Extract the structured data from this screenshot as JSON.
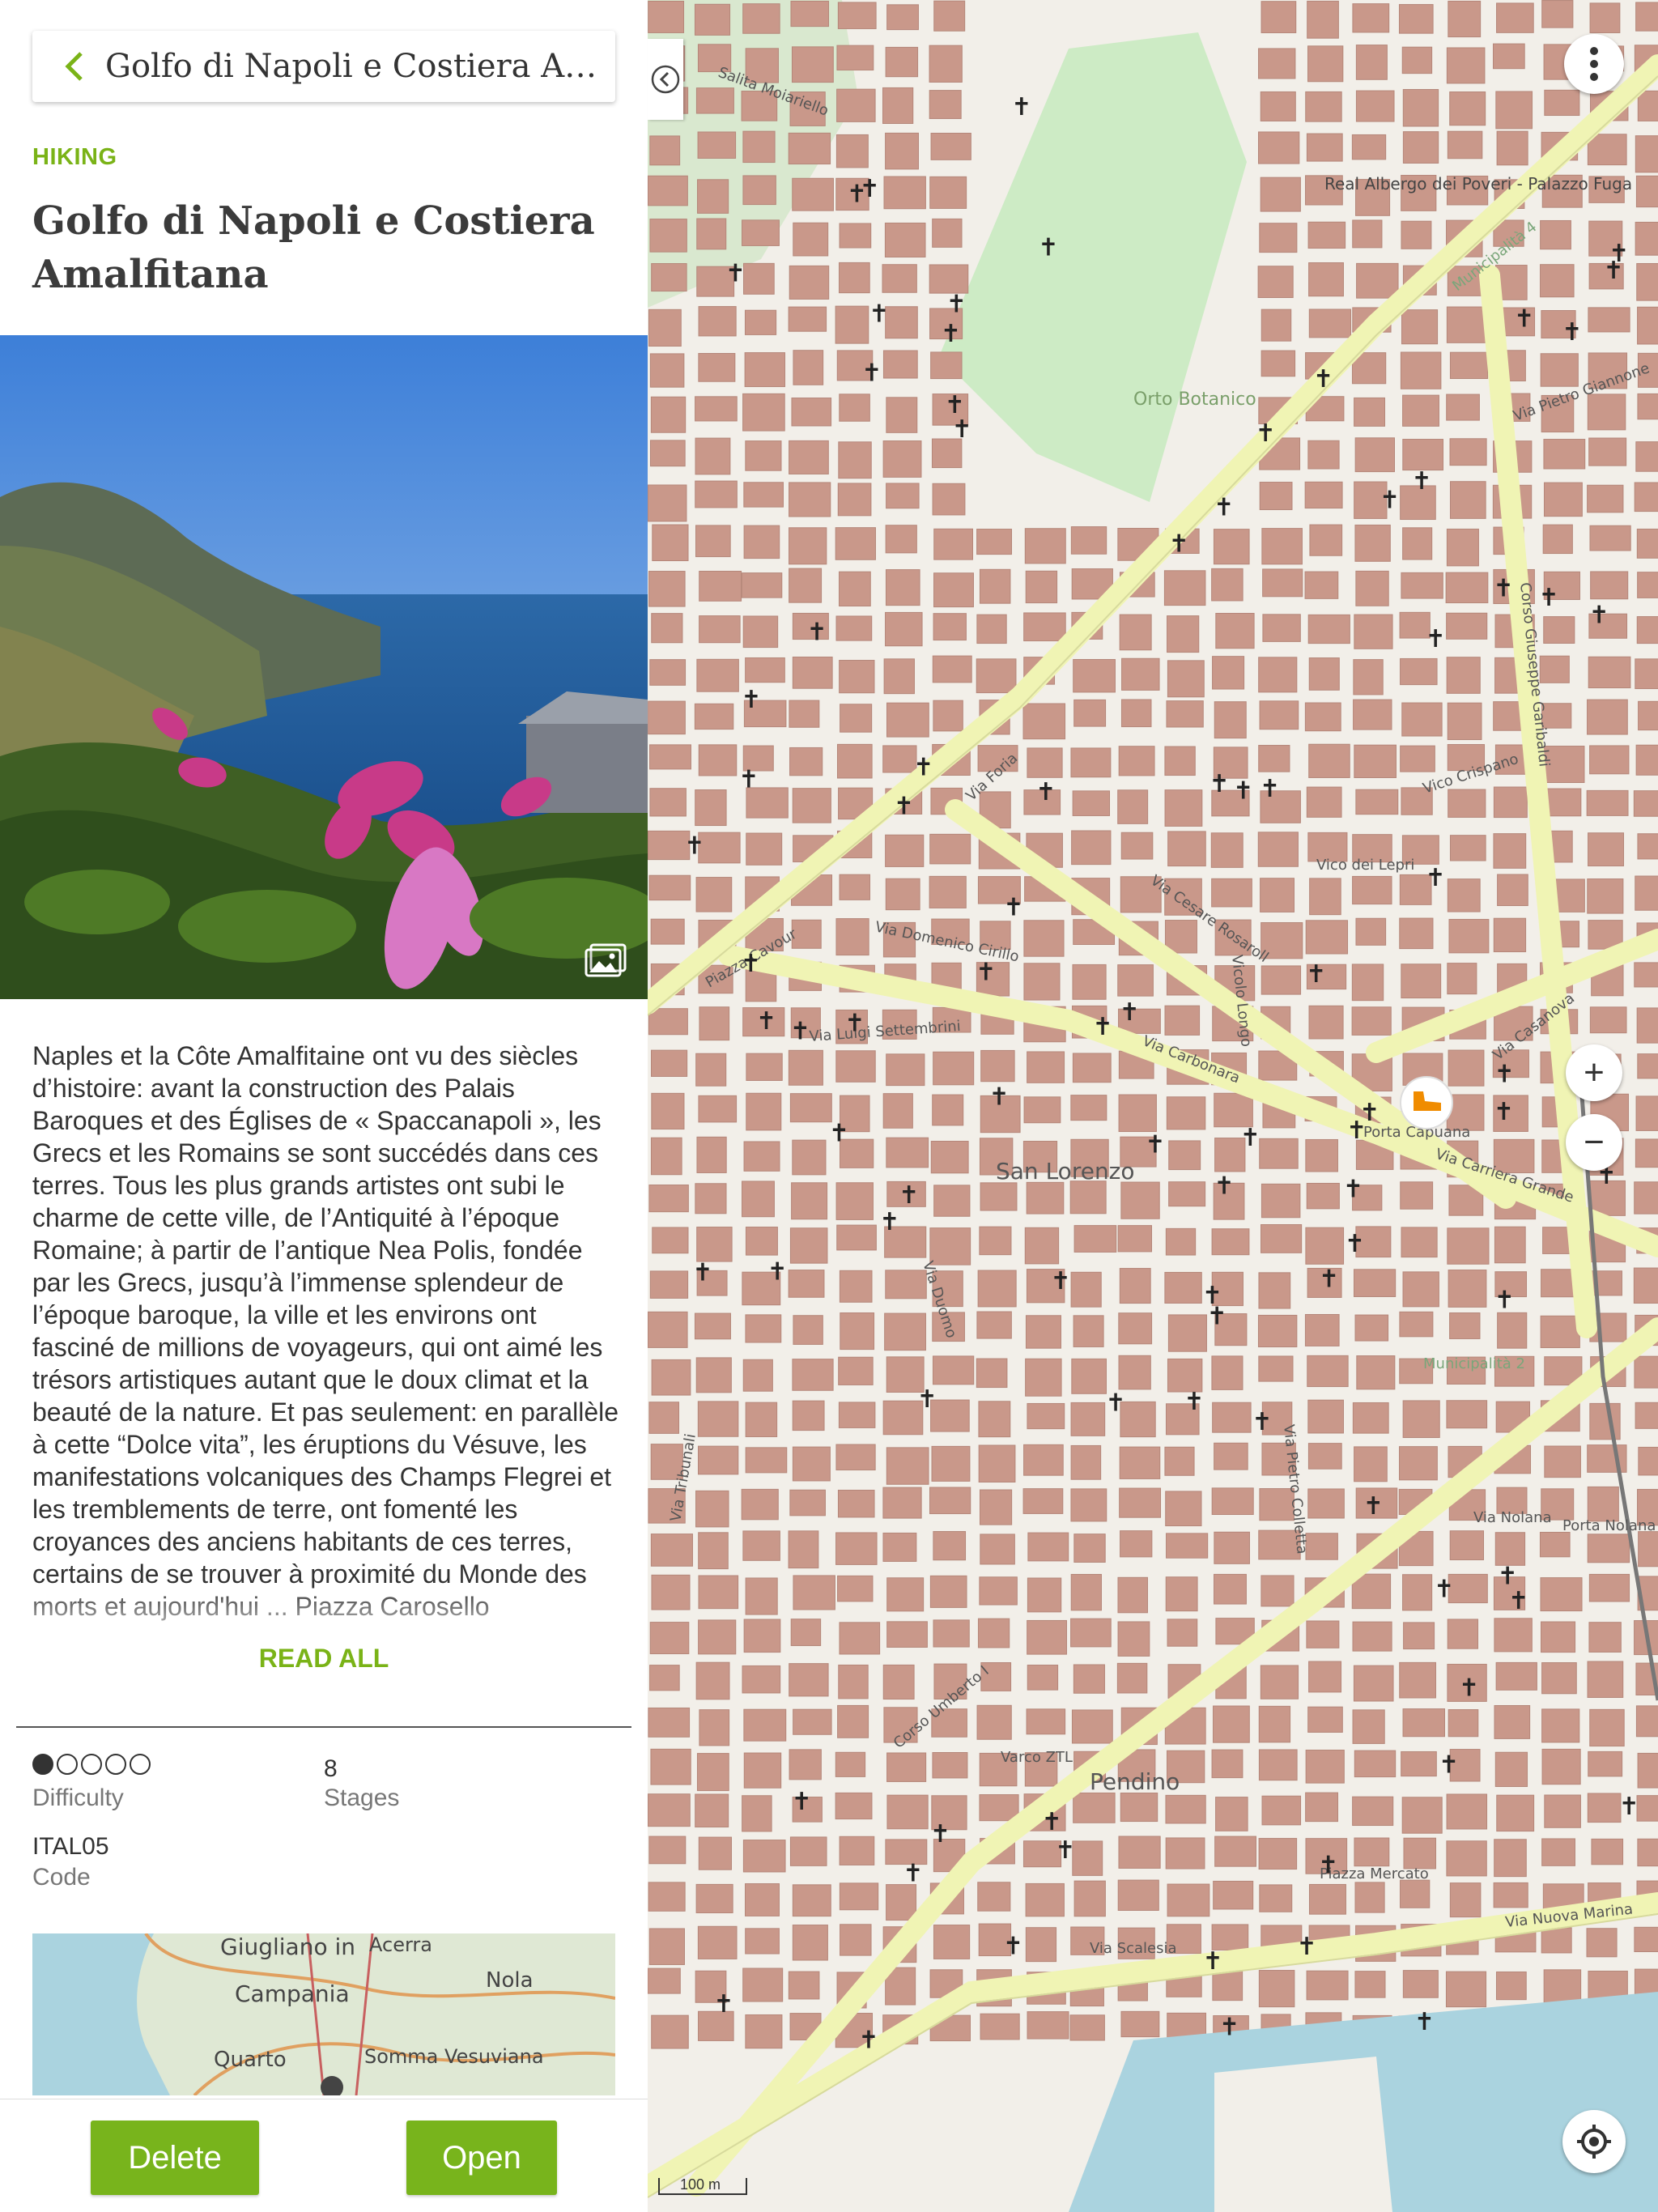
{
  "header": {
    "back_label": "Back",
    "title": "Golfo di Napoli e Costiera Amalfitana"
  },
  "tour": {
    "category": "HIKING",
    "title": "Golfo di Napoli e Costiera Amalfitana",
    "description": "Naples et la Côte Amalfitaine ont vu des siècles d’histoire: avant la construction des Palais Baroques et des Églises de « Spaccanapoli », les Grecs et les Romains se sont succédés dans ces terres. Tous les plus grands artistes ont subi le charme de cette ville, de l’Antiquité à l’époque Romaine; à partir de l’antique Nea Polis, fondée par les Grecs, jusqu’à l’immense splendeur de l’époque baroque, la ville et les environs ont fasciné de millions de voyageurs, qui ont aimé les trésors artistiques autant que le doux climat et la beauté de la nature. Et pas seulement: en parallèle à cette “Dolce vita”, les éruptions du Vésuve, les manifestations volcaniques des Champs Flegrei et les tremblements de terre, ont fomenté les croyances des anciens habitants de ces terres, certains de se trouver à proximité du Monde des morts et aujourd'hui ... Piazza Carosello",
    "read_all": "READ ALL",
    "difficulty_level": 1,
    "difficulty_max": 5,
    "difficulty_label": "Difficulty",
    "stages_value": "8",
    "stages_label": "Stages",
    "code_value": "ITAL05",
    "code_label": "Code"
  },
  "minimap": {
    "labels": [
      "Giugliano in",
      "Campania",
      "Acerra",
      "Nola",
      "Quarto",
      "Somma Vesuviana"
    ]
  },
  "actions": {
    "delete_label": "Delete",
    "open_label": "Open"
  },
  "map": {
    "district_labels": [
      "San Lorenzo",
      "Pendino",
      "Orto Botanico",
      "Porta Capuana",
      "Municipalità 4",
      "Municipalità 2"
    ],
    "street_labels": [
      "Via Foria",
      "Via Cesare Rosaroll",
      "Via Carbonara",
      "Corso Umberto I",
      "Corso Giuseppe Garibaldi",
      "Via Nuova Marina",
      "Via Duomo",
      "Via Domenico Cirillo",
      "Via Luigi Settembrini",
      "Via Casanova",
      "Via Carriera Grande",
      "Piazza Mercato",
      "Via Tribunali",
      "Via Nolana",
      "Vico dei Lepri",
      "Vico Crispano",
      "Via Pietro Colletta",
      "Vicolo Longo",
      "Via Scalesia",
      "Piazza Cavour",
      "Salita Moiariello",
      "Real Albergo dei Poveri - Palazzo Fuga",
      "Porta Nolana",
      "Varco ZTL",
      "Via Pietro Giannone"
    ],
    "scale_label": "100 m",
    "menu_icon": "more-vert-icon",
    "zoom_in_label": "+",
    "zoom_out_label": "−",
    "colors": {
      "building": "#c9988a",
      "road": "#ffffff",
      "primary_road": "#f0f4b4",
      "park": "#cdebc5",
      "sea": "#aad3df",
      "ground": "#f2efe9"
    }
  },
  "theme": {
    "accent": "#78b41c",
    "category_color": "#7ab317"
  }
}
